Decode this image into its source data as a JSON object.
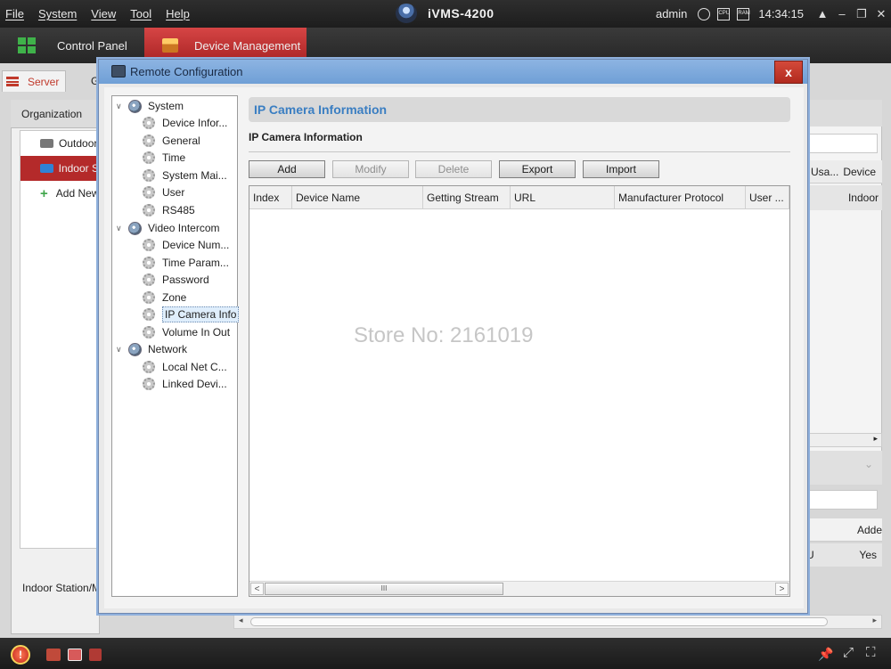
{
  "app": {
    "title": "iVMS-4200",
    "menu": [
      "File",
      "System",
      "View",
      "Tool",
      "Help"
    ],
    "user": "admin",
    "cpu_label": "CPU",
    "ram_label": "RAM",
    "time": "14:34:15",
    "window_controls": [
      "▲",
      "–",
      "❐",
      "✕"
    ]
  },
  "tabs": {
    "control_panel": "Control Panel",
    "device_management": "Device Management"
  },
  "background": {
    "subtab_server": "Server",
    "subtab_group_abbr": "G",
    "organization_label": "Organization",
    "org_items": [
      "Outdoor",
      "Indoor S",
      "Add New"
    ],
    "footer_label": "Indoor Station/M",
    "right_columns": [
      "Usa...",
      "Device"
    ],
    "right_row_value": "Indoor",
    "right_bottom_header": "Adde",
    "right_bottom_row": [
      "U",
      "Yes"
    ]
  },
  "dialog": {
    "title": "Remote Configuration",
    "close": "x",
    "tree": [
      {
        "label": "System",
        "level": 0,
        "expander": "∨",
        "icon": "globe-icon"
      },
      {
        "label": "Device Infor...",
        "level": 1,
        "icon": "gear-icon"
      },
      {
        "label": "General",
        "level": 1,
        "icon": "gear-icon"
      },
      {
        "label": "Time",
        "level": 1,
        "icon": "gear-icon"
      },
      {
        "label": "System Mai...",
        "level": 1,
        "icon": "gear-icon"
      },
      {
        "label": "User",
        "level": 1,
        "icon": "gear-icon"
      },
      {
        "label": "RS485",
        "level": 1,
        "icon": "gear-icon"
      },
      {
        "label": "Video Intercom",
        "level": 0,
        "expander": "∨",
        "icon": "globe-icon"
      },
      {
        "label": "Device Num...",
        "level": 1,
        "icon": "gear-icon"
      },
      {
        "label": "Time Param...",
        "level": 1,
        "icon": "gear-icon"
      },
      {
        "label": "Password",
        "level": 1,
        "icon": "gear-icon"
      },
      {
        "label": "Zone",
        "level": 1,
        "icon": "gear-icon"
      },
      {
        "label": "IP Camera Info",
        "level": 1,
        "icon": "gear-icon",
        "selected": true
      },
      {
        "label": "Volume In Out",
        "level": 1,
        "icon": "gear-icon"
      },
      {
        "label": "Network",
        "level": 0,
        "expander": "∨",
        "icon": "globe-icon"
      },
      {
        "label": "Local Net C...",
        "level": 1,
        "icon": "gear-icon"
      },
      {
        "label": "Linked Devi...",
        "level": 1,
        "icon": "gear-icon"
      }
    ],
    "header": "IP Camera Information",
    "subheader": "IP Camera Information",
    "buttons": [
      {
        "label": "Add",
        "enabled": true
      },
      {
        "label": "Modify",
        "enabled": false
      },
      {
        "label": "Delete",
        "enabled": false
      },
      {
        "label": "Export",
        "enabled": true
      },
      {
        "label": "Import",
        "enabled": true
      }
    ],
    "columns": [
      "Index",
      "Device Name",
      "Getting Stream",
      "URL",
      "Manufacturer Protocol",
      "User ..."
    ],
    "rows": [],
    "scroll_thumb": "III",
    "scroll_left": "<",
    "scroll_right": ">"
  },
  "watermark": "Store No: 2161019",
  "colors": {
    "accent_red": "#b42a2a",
    "header_blue": "#3a7ec2",
    "dialog_title": "#8db4e2"
  }
}
